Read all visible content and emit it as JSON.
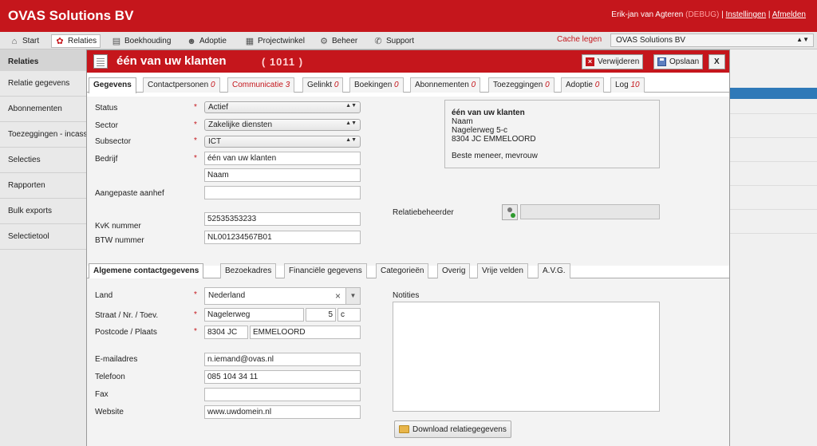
{
  "app": {
    "title": "OVAS Solutions BV"
  },
  "user": {
    "name": "Erik-jan van Agteren",
    "debug": "(DEBUG)",
    "sep": "|",
    "settings": "Instellingen",
    "logout": "Afmelden"
  },
  "menu": [
    {
      "label": "Start",
      "icon": "home-icon"
    },
    {
      "label": "Relaties",
      "icon": "relations-icon"
    },
    {
      "label": "Boekhouding",
      "icon": "accounting-icon"
    },
    {
      "label": "Adoptie",
      "icon": "person-icon"
    },
    {
      "label": "Projectwinkel",
      "icon": "project-icon"
    },
    {
      "label": "Beheer",
      "icon": "gear-icon"
    },
    {
      "label": "Support",
      "icon": "support-icon"
    }
  ],
  "cache": "Cache legen",
  "company_select": "OVAS Solutions BV",
  "sidebar": {
    "heading": "Relaties",
    "items": [
      "Relatie gegevens",
      "Abonnementen",
      "Toezeggingen - incasso",
      "Selecties",
      "Rapporten",
      "Bulk exports",
      "Selectietool"
    ]
  },
  "modal": {
    "title": "één van uw klanten",
    "count": "( 1011 )",
    "buttons": {
      "delete": "Verwijderen",
      "save": "Opslaan",
      "close": "X"
    },
    "tabs": [
      {
        "label": "Gegevens",
        "count": ""
      },
      {
        "label": "Contactpersonen",
        "count": "0"
      },
      {
        "label": "Communicatie",
        "count": "3"
      },
      {
        "label": "Gelinkt",
        "count": "0"
      },
      {
        "label": "Boekingen",
        "count": "0"
      },
      {
        "label": "Abonnementen",
        "count": "0"
      },
      {
        "label": "Toezeggingen",
        "count": "0"
      },
      {
        "label": "Adoptie",
        "count": "0"
      },
      {
        "label": "Log",
        "count": "10"
      }
    ],
    "form": {
      "status": {
        "label": "Status",
        "value": "Actief"
      },
      "sector": {
        "label": "Sector",
        "value": "Zakelijke diensten"
      },
      "subsector": {
        "label": "Subsector",
        "value": "ICT"
      },
      "bedrijf": {
        "label": "Bedrijf",
        "value1": "één van uw klanten",
        "value2": "Naam"
      },
      "aanhef": {
        "label": "Aangepaste aanhef",
        "value": ""
      },
      "kvk": {
        "label": "KvK nummer",
        "value": "52535353233"
      },
      "btw": {
        "label": "BTW nummer",
        "value": "NL001234567B01"
      },
      "relatiebeheerder": {
        "label": "Relatiebeheerder",
        "value": ""
      },
      "required_mark": "*"
    },
    "address_card": {
      "name": "één van uw klanten",
      "line1": "Naam",
      "line2": "Nagelerweg 5-c",
      "line3": "8304 JC EMMELOORD",
      "greeting": "Beste meneer, mevrouw"
    },
    "subtabs": [
      "Algemene contactgegevens",
      "Bezoekadres",
      "Financiële gegevens",
      "Categorieën",
      "Overig",
      "Vrije velden",
      "A.V.G."
    ],
    "contact": {
      "land": {
        "label": "Land",
        "value": "Nederland",
        "clear": "×"
      },
      "straat": {
        "label": "Straat / Nr. / Toev.",
        "street": "Nagelerweg",
        "number": "5",
        "addition": "c"
      },
      "postcode": {
        "label": "Postcode / Plaats",
        "postcode": "8304 JC",
        "city": "EMMELOORD"
      },
      "email": {
        "label": "E-mailadres",
        "value": "n.iemand@ovas.nl"
      },
      "telefoon": {
        "label": "Telefoon",
        "value": "085 104 34 11"
      },
      "fax": {
        "label": "Fax",
        "value": ""
      },
      "website": {
        "label": "Website",
        "value": "www.uwdomein.nl"
      },
      "notities": {
        "label": "Notities",
        "value": ""
      },
      "download": "Download relatiegegevens"
    }
  }
}
